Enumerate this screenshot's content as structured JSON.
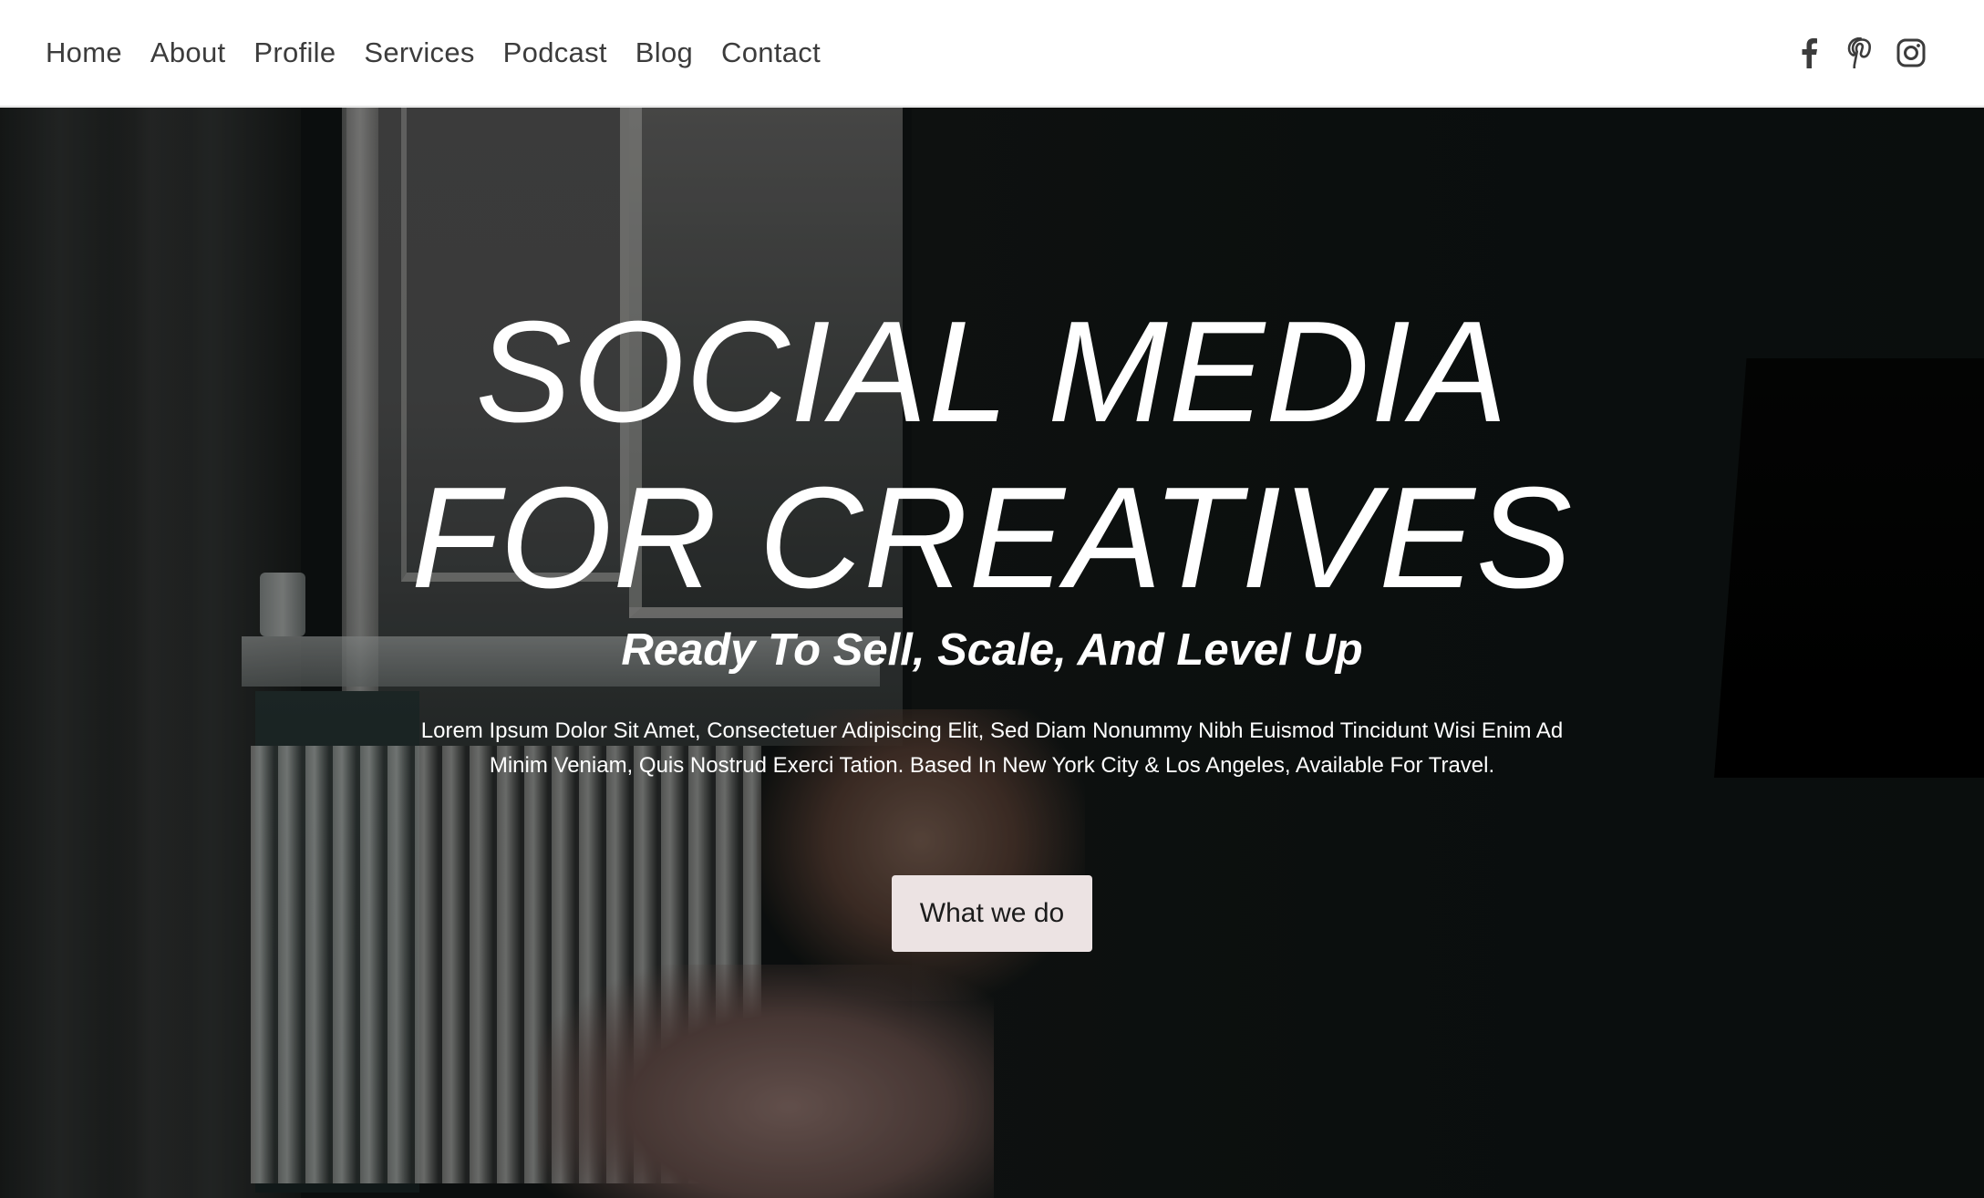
{
  "nav": {
    "items": [
      {
        "label": "Home"
      },
      {
        "label": "About"
      },
      {
        "label": "Profile"
      },
      {
        "label": "Services"
      },
      {
        "label": "Podcast"
      },
      {
        "label": "Blog"
      },
      {
        "label": "Contact"
      }
    ]
  },
  "social": {
    "icons": [
      "facebook-icon",
      "pinterest-icon",
      "instagram-icon"
    ],
    "color": "#3c3c3c"
  },
  "hero": {
    "title_line1": "SOCIAL MEDIA",
    "title_line2": "FOR CREATIVES",
    "subtitle": "Ready To Sell, Scale, And Level Up",
    "description_line1": "Lorem Ipsum Dolor Sit Amet, Consectetuer Adipiscing Elit, Sed Diam Nonummy Nibh Euismod Tincidunt Wisi Enim Ad",
    "description_line2": "Minim Veniam, Quis Nostrud Exerci Tation. Based In New York City & Los Angeles, Available For Travel.",
    "cta_label": "What we do"
  },
  "colors": {
    "header_bg": "#ffffff",
    "nav_text": "#3c3c3c",
    "hero_text": "#ffffff",
    "cta_bg": "#ece3e3",
    "cta_text": "#1c1c1c"
  }
}
